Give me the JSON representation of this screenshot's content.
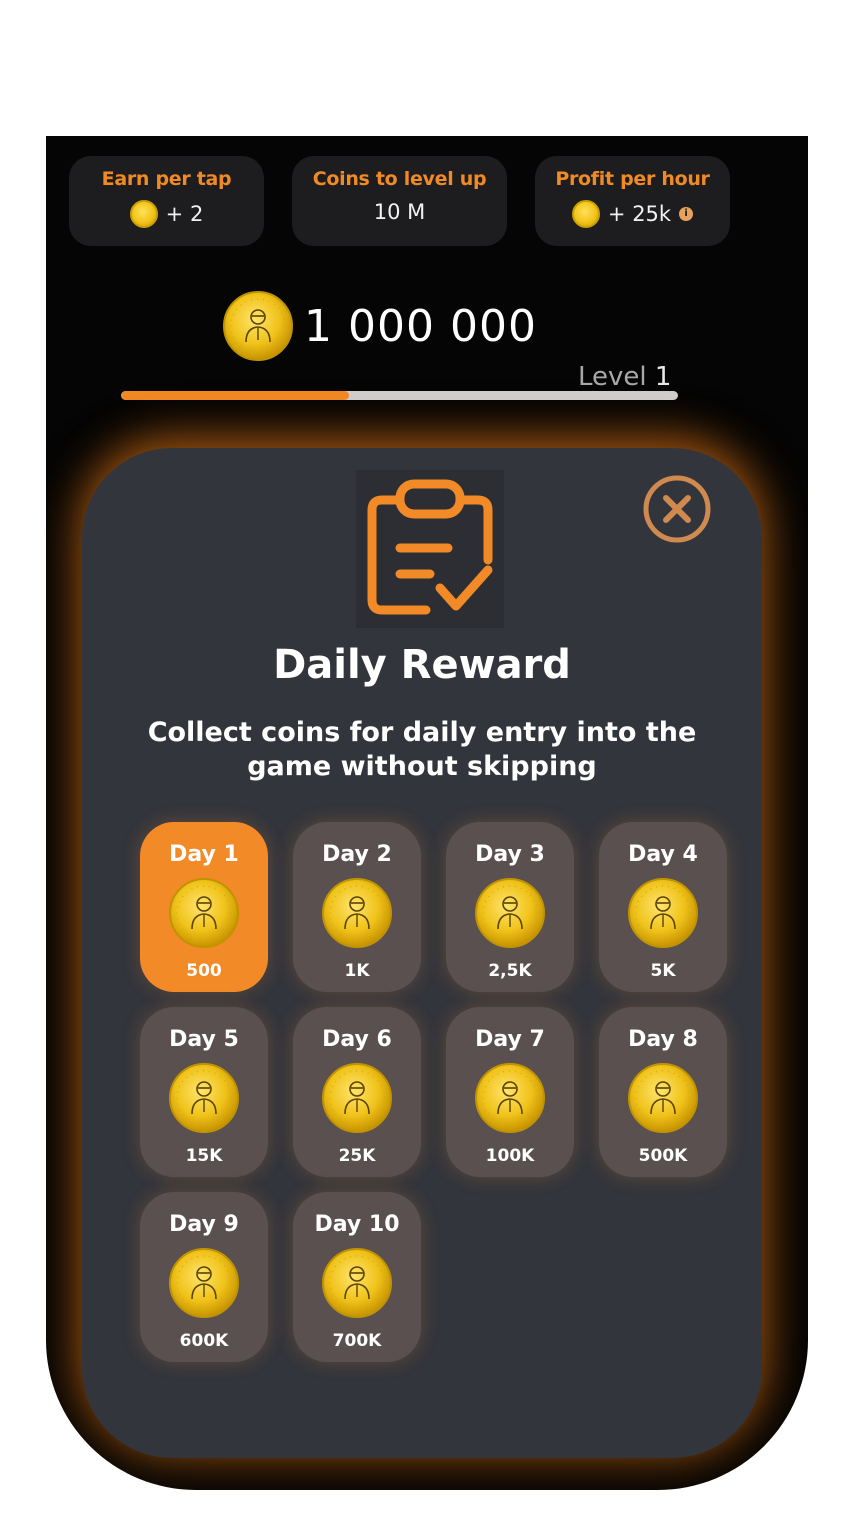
{
  "stats": [
    {
      "title": "Earn per tap",
      "value": "+ 2",
      "icon": "coin-icon"
    },
    {
      "title": "Coins to level up",
      "value": "10 M"
    },
    {
      "title": "Profit per hour",
      "value": "+ 25k",
      "icon": "coin-icon",
      "info_icon": "info-icon"
    }
  ],
  "balance": {
    "value": "1 000 000"
  },
  "level": {
    "label": "Level",
    "number": "1",
    "progress_fraction": 0.41
  },
  "modal": {
    "title": "Daily Reward",
    "description": "Collect coins for daily entry into the game without skipping",
    "header_icon": "clipboard-check-icon",
    "close_icon": "close-icon"
  },
  "days": [
    {
      "label": "Day 1",
      "amount": "500",
      "active": true
    },
    {
      "label": "Day 2",
      "amount": "1K"
    },
    {
      "label": "Day 3",
      "amount": "2,5K"
    },
    {
      "label": "Day 4",
      "amount": "5K"
    },
    {
      "label": "Day 5",
      "amount": "15K"
    },
    {
      "label": "Day 6",
      "amount": "25K"
    },
    {
      "label": "Day 7",
      "amount": "100K"
    },
    {
      "label": "Day 8",
      "amount": "500K"
    },
    {
      "label": "Day 9",
      "amount": "600K"
    },
    {
      "label": "Day 10",
      "amount": "700K"
    }
  ],
  "colors": {
    "accent": "#f08a24",
    "modal_bg": "#33353c",
    "card_bg": "#5a5050",
    "coin": "#f2c41a"
  }
}
